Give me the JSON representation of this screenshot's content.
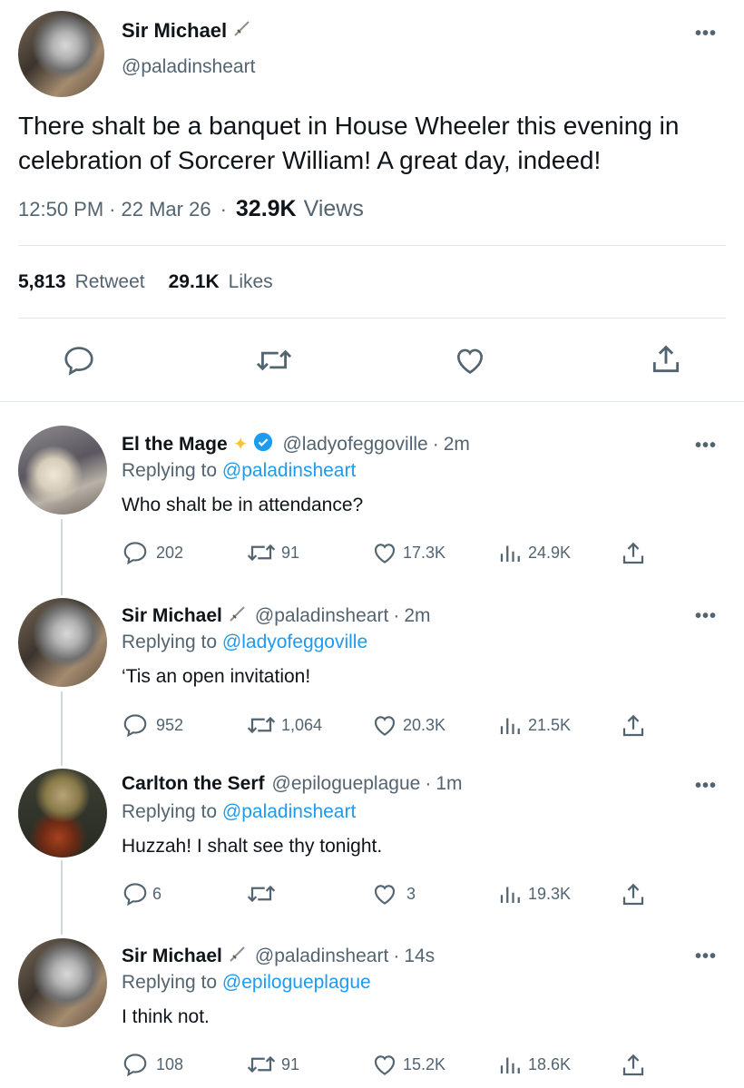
{
  "main_tweet": {
    "name": "Sir Michael",
    "name_emoji": "🗡",
    "handle": "@paladinsheart",
    "text": "There shalt be a banquet in House Wheeler this evening in celebration of Sorcerer William! A great day, indeed!",
    "time": "12:50 PM",
    "date": "22 Mar 26",
    "views_count": "32.9K",
    "views_label": "Views",
    "retweets_count": "5,813",
    "retweets_label": "Retweet",
    "likes_count": "29.1K",
    "likes_label": "Likes"
  },
  "replies": [
    {
      "name": "El the Mage",
      "name_emoji": "✨",
      "verified": true,
      "handle": "@ladyofeggoville",
      "age": "2m",
      "replying_label": "Replying to",
      "replying_to": "@paladinsheart",
      "text": "Who shalt be in attendance?",
      "replies": "202",
      "retweets": "91",
      "likes": "17.3K",
      "views": "24.9K"
    },
    {
      "name": "Sir Michael",
      "name_emoji": "🗡",
      "verified": false,
      "handle": "@paladinsheart",
      "age": "2m",
      "replying_label": "Replying to",
      "replying_to": "@ladyofeggoville",
      "text": "‘Tis an open invitation!",
      "replies": "952",
      "retweets": "1,064",
      "likes": "20.3K",
      "views": "21.5K"
    },
    {
      "name": "Carlton the Serf",
      "name_emoji": "",
      "verified": false,
      "handle": "@epilogueplague",
      "age": "1m",
      "replying_label": "Replying to",
      "replying_to": "@paladinsheart",
      "text": "Huzzah! I shalt see thy tonight.",
      "replies": "6",
      "retweets": "",
      "likes": "3",
      "views": "19.3K"
    },
    {
      "name": "Sir Michael",
      "name_emoji": "🗡",
      "verified": false,
      "handle": "@paladinsheart",
      "age": "14s",
      "replying_label": "Replying to",
      "replying_to": "@epilogueplague",
      "text": "I think not.",
      "replies": "108",
      "retweets": "91",
      "likes": "15.2K",
      "views": "18.6K"
    }
  ],
  "colors": {
    "link": "#1d9bf0",
    "muted": "#536471",
    "divider": "#e1e6ea",
    "sparkle": "#f5c542"
  },
  "icons": [
    "reply-icon",
    "retweet-icon",
    "like-icon",
    "views-icon",
    "share-icon",
    "more-icon",
    "verified-badge-icon",
    "dagger-icon",
    "sparkles-icon"
  ]
}
